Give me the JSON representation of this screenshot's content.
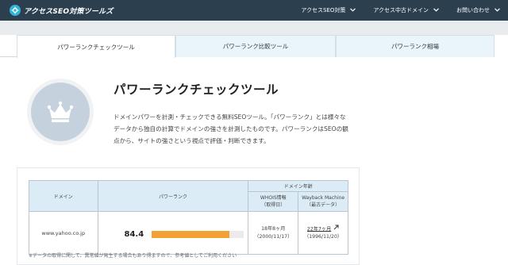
{
  "header": {
    "logo_text": "アクセスSEO対策ツールズ",
    "logo_icon": "gear-badge-icon",
    "nav": [
      {
        "label": "アクセスSEO対策"
      },
      {
        "label": "アクセス中古ドメイン"
      },
      {
        "label": "お問い合わせ"
      }
    ]
  },
  "tabs": [
    {
      "label": "パワーランクチェックツール",
      "active": true
    },
    {
      "label": "パワーランク比較ツール",
      "active": false
    },
    {
      "label": "パワーランク相場",
      "active": false
    }
  ],
  "hero": {
    "icon": "crown-icon",
    "title": "パワーランクチェックツール",
    "description": "ドメインパワーを計測・チェックできる無料SEOツール。「パワーランク」とは様々なデータから独自の計算でドメインの強さを計測したものです。パワーランクはSEOの観点から、サイトの強さという視点で評価・判断できます。"
  },
  "table": {
    "headers": {
      "domain": "ドメイン",
      "power_rank": "パワーランク",
      "domain_age": "ドメイン年齢",
      "whois_line1": "WHOIS情報",
      "whois_line2": "（取得日）",
      "wayback_line1": "Wayback Machine",
      "wayback_line2": "（最古データ）"
    },
    "row": {
      "domain": "www.yahoo.co.jp",
      "score": "84.4",
      "score_fraction": 0.844,
      "whois_age": "18年8ヶ月",
      "whois_date": "（2000/11/17）",
      "wayback_age": "22年7ヶ月",
      "wayback_date": "（1996/11/20）"
    }
  },
  "note": "※データの取得に関して、異常値が発生する場合もあり得ますので、参考値としてご利用ください",
  "colors": {
    "header_bg": "#2b3f4f",
    "logo_accent": "#2fb4d8",
    "bar": "#f2a135",
    "table_header": "#dcecf6"
  }
}
